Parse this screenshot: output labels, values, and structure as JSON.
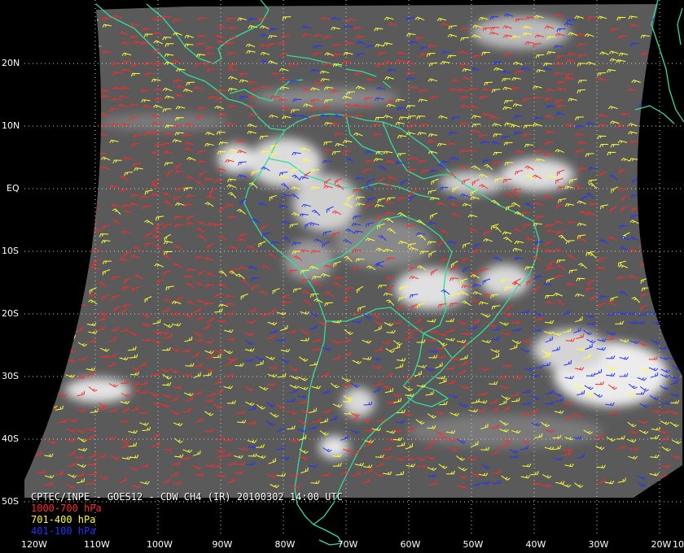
{
  "map": {
    "caption": "CPTEC/INPE - GOES12 - CDW CH4 (IR) 20100302 14:00 UTC",
    "lat_labels": [
      {
        "text": "20N",
        "lat": 20
      },
      {
        "text": "10N",
        "lat": 10
      },
      {
        "text": "EQ",
        "lat": 0
      },
      {
        "text": "10S",
        "lat": -10
      },
      {
        "text": "20S",
        "lat": -20
      },
      {
        "text": "30S",
        "lat": -30
      },
      {
        "text": "40S",
        "lat": -40
      },
      {
        "text": "50S",
        "lat": -50
      }
    ],
    "lon_labels": [
      {
        "text": "120W",
        "lon": -120
      },
      {
        "text": "110W",
        "lon": -110
      },
      {
        "text": "100W",
        "lon": -100
      },
      {
        "text": "90W",
        "lon": -90
      },
      {
        "text": "80W",
        "lon": -80
      },
      {
        "text": "70W",
        "lon": -70
      },
      {
        "text": "60W",
        "lon": -60
      },
      {
        "text": "50W",
        "lon": -50
      },
      {
        "text": "40W",
        "lon": -40
      },
      {
        "text": "30W",
        "lon": -30
      },
      {
        "text": "20W",
        "lon": -20
      },
      {
        "text": "10",
        "lon": -10
      }
    ],
    "legend": [
      {
        "label": "1000-700 hPa",
        "color": "#ff2a2a"
      },
      {
        "label": "701-400 hPa",
        "color": "#ffff33"
      },
      {
        "label": "401-100 hPa",
        "color": "#2233ff"
      }
    ],
    "colors": {
      "coastline": "#33dd99",
      "grid": "#cccccc",
      "image_bg": "#5a5a5a",
      "cloud": "#e8e8e8"
    }
  }
}
